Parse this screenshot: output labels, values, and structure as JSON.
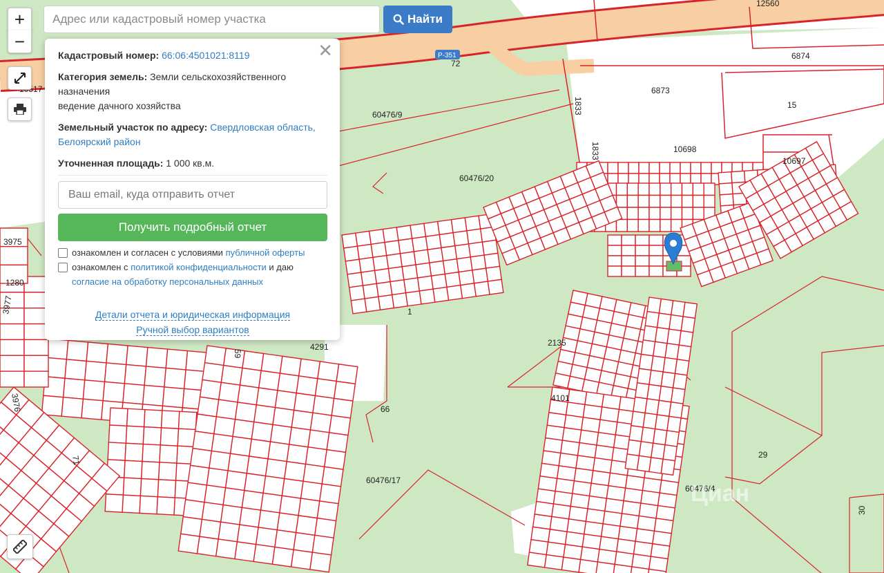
{
  "map": {
    "zoom_in_label": "+",
    "zoom_out_label": "−",
    "parcel_labels": [
      "12560",
      "6874",
      "6873",
      "15",
      "1833",
      "1833",
      "10698",
      "10697",
      "10517",
      "60476/9",
      "60476/20",
      "3975",
      "1280",
      "3977",
      "3976",
      "4291",
      "2135",
      "4101",
      "29",
      "60476/17",
      "60476/4",
      "30",
      "66",
      "59",
      "71",
      "1"
    ],
    "road_label": "72",
    "road_shield": "Р-351",
    "colors": {
      "forest": "#cfe8c4",
      "forest_dark": "#bfe0b2",
      "parcel_line": "#d8232a",
      "road": "#f6c49a",
      "land": "#ffffff",
      "marker": "#2a7dd1",
      "selected": "#66bb6a"
    }
  },
  "search": {
    "placeholder": "Адрес или кадастровый номер участка",
    "button_label": "Найти"
  },
  "popup": {
    "close_label": "✕",
    "cadastral_label": "Кадастровый номер:",
    "cadastral_value": "66:06:4501021:8119",
    "category_label": "Категория земель:",
    "category_value": "Земли сельскохозяйственного назначения",
    "category_use": "ведение дачного хозяйства",
    "address_label": "Земельный участок по адресу:",
    "address_value": "Свердловская область, Белоярский район",
    "area_label": "Уточненная площадь:",
    "area_value": "1 000 кв.м.",
    "email_placeholder": "Ваш email, куда отправить отчет",
    "report_button": "Получить подробный отчет",
    "consent1_text": "ознакомлен и согласен с условиями ",
    "consent1_link": "публичной оферты",
    "consent2_text": "ознакомлен с ",
    "consent2_link": "политикой конфиденциальности",
    "consent2_mid": " и даю ",
    "consent2_link2": "согласие на обработку персональных данных",
    "details_link": "Детали отчета и юридическая информация",
    "manual_link": "Ручной выбор вариантов"
  }
}
